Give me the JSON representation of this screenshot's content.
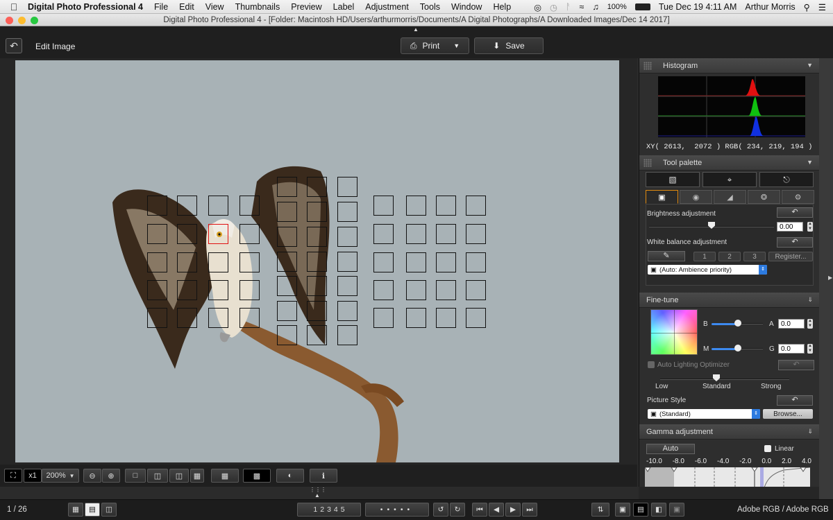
{
  "menubar": {
    "app_name": "Digital Photo Professional 4",
    "items": [
      "File",
      "Edit",
      "View",
      "Thumbnails",
      "Preview",
      "Label",
      "Adjustment",
      "Tools",
      "Window",
      "Help"
    ],
    "battery": "100%",
    "clock": "Tue Dec 19  4:11 AM",
    "user": "Arthur Morris"
  },
  "window": {
    "title": "Digital Photo Professional 4 - [Folder: Macintosh HD/Users/arthurmorris/Documents/A Digital Photographs/A Downloaded Images/Dec 14 2017]"
  },
  "toolbar": {
    "back_icon": "undo-arrow-icon",
    "title": "Edit Image",
    "print_label": "Print",
    "save_label": "Save"
  },
  "histogram": {
    "title": "Histogram",
    "readout": "XY( 2613,  2072 ) RGB( 234, 219, 194 )",
    "colors": {
      "red": "#e01010",
      "green": "#10c010",
      "blue": "#1030e0"
    }
  },
  "tool_palette": {
    "title": "Tool palette",
    "brightness": {
      "label": "Brightness adjustment",
      "value": "0.00",
      "level": 0.5
    },
    "white_balance": {
      "label": "White balance adjustment",
      "slots": [
        "1",
        "2",
        "3"
      ],
      "register_label": "Register...",
      "mode": "(Auto: Ambience priority)"
    }
  },
  "fine_tune": {
    "title": "Fine-tune",
    "b_label": "B",
    "a_label": "A",
    "a_value": "0.0",
    "m_label": "M",
    "g_label": "G",
    "g_value": "0.0",
    "alo_label": "Auto Lighting Optimizer",
    "alo_levels": [
      "Low",
      "Standard",
      "Strong"
    ],
    "picture_style_label": "Picture Style",
    "picture_style_value": "(Standard)",
    "browse_label": "Browse..."
  },
  "gamma": {
    "title": "Gamma adjustment",
    "auto_label": "Auto",
    "linear_label": "Linear",
    "scale": [
      "-10.0",
      "-8.0",
      "-6.0",
      "-4.0",
      "-2.0",
      "0.0",
      "2.0",
      "4.0"
    ]
  },
  "view_controls": {
    "zoom_fit_label": "x1",
    "zoom_level": "200%"
  },
  "bottom_bar": {
    "page_counter": "1 / 26",
    "ratings": [
      "1",
      "2",
      "3",
      "4",
      "5"
    ],
    "color_space": "Adobe RGB / Adobe RGB"
  }
}
